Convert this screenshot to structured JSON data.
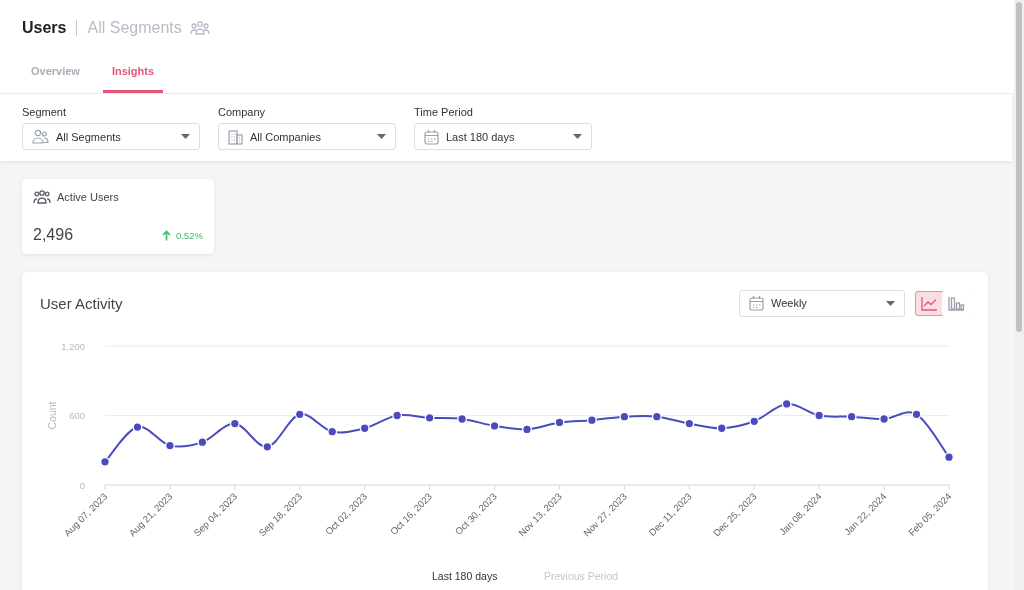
{
  "header": {
    "title": "Users",
    "subtitle": "All Segments"
  },
  "tabs": [
    {
      "label": "Overview",
      "selected": false
    },
    {
      "label": "Insights",
      "selected": true
    }
  ],
  "filters": [
    {
      "label": "Segment",
      "value": "All Segments",
      "kind": "users"
    },
    {
      "label": "Company",
      "value": "All Companies",
      "kind": "building"
    },
    {
      "label": "Time Period",
      "value": "Last 180 days",
      "kind": "calendar"
    }
  ],
  "stat_card": {
    "title": "Active Users",
    "value": "2,496",
    "change": "0.52%"
  },
  "activity": {
    "title": "User Activity",
    "interval": "Weekly",
    "chart_types": [
      {
        "kind": "line",
        "selected": true
      },
      {
        "kind": "bar",
        "selected": false
      }
    ],
    "legend": [
      {
        "label": "Last 180 days",
        "selected": true
      },
      {
        "label": "Previous Period",
        "selected": false
      }
    ],
    "chart_data": {
      "type": "line",
      "ylabel": "Count",
      "categories": [
        "Aug 07, 2023",
        null,
        "Aug 21, 2023",
        null,
        "Sep 04, 2023",
        null,
        "Sep 18, 2023",
        null,
        "Oct 02, 2023",
        null,
        "Oct 16, 2023",
        null,
        "Oct 30, 2023",
        null,
        "Nov 13, 2023",
        null,
        "Nov 27, 2023",
        null,
        "Dec 11, 2023",
        null,
        "Dec 25, 2023",
        null,
        "Jan 08, 2024",
        null,
        "Jan 22, 2024",
        null,
        "Feb 05, 2024"
      ],
      "series": [
        {
          "color": "#4a4bbd",
          "marker": "circle",
          "values": [
            200,
            500,
            340,
            370,
            530,
            330,
            610,
            460,
            490,
            600,
            580,
            570,
            510,
            480,
            540,
            560,
            590,
            590,
            530,
            490,
            550,
            700,
            600,
            590,
            570,
            610,
            240
          ]
        }
      ],
      "ylim": [
        0,
        1200
      ],
      "yticks": [
        {
          "value": 0,
          "label": "0"
        },
        {
          "value": 600,
          "label": "600"
        },
        {
          "value": 1200,
          "label": "1,200"
        }
      ]
    }
  }
}
